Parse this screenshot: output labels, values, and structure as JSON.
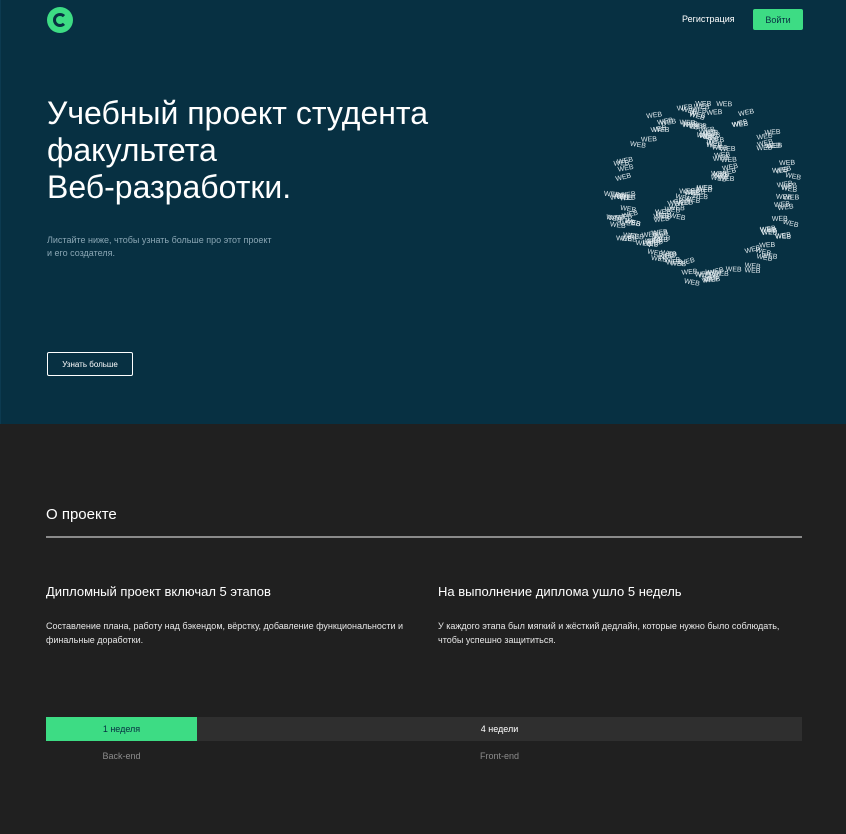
{
  "header": {
    "logo_icon": "c-logo-icon",
    "register_label": "Регистрация",
    "login_label": "Войти"
  },
  "hero": {
    "title_line1": "Учебный проект студента",
    "title_line2": "факультета",
    "title_line3": "Веб-разработки.",
    "subtitle": "Листайте ниже, чтобы узнать больше про этот проект и его создателя.",
    "more_button": "Узнать больше",
    "globe_word": "WEB"
  },
  "about": {
    "title": "О проекте",
    "col1": {
      "heading": "Дипломный проект включал 5 этапов",
      "text": "Составление плана, работу над бэкендом, вёрстку, добавление функциональности и финальные доработки."
    },
    "col2": {
      "heading": "На выполнение диплома ушло 5 недель",
      "text": "У каждого этапа был мягкий и жёсткий дедлайн, которые нужно было соблюдать, чтобы успешно защититься."
    }
  },
  "timeline": {
    "segments": [
      {
        "duration": "1 неделя",
        "label": "Back-end"
      },
      {
        "duration": "4 недели",
        "label": "Front-end"
      }
    ]
  },
  "colors": {
    "accent": "#3ddc84",
    "hero_bg": "#073042",
    "body_bg": "#202020"
  }
}
